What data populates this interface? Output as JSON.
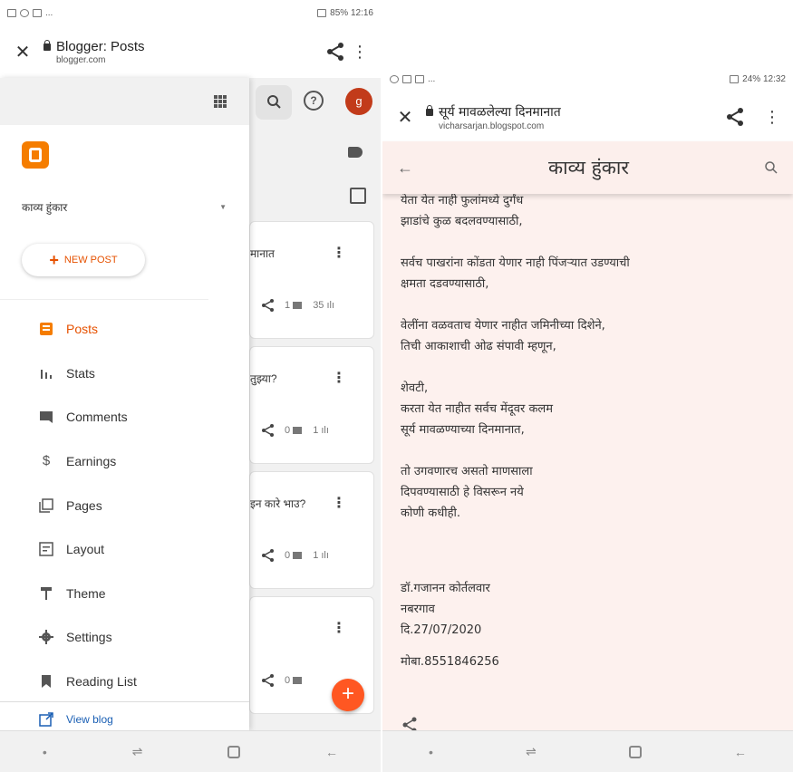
{
  "left_phone": {
    "status": {
      "right": "85%  12:16",
      "left": "..."
    },
    "browser": {
      "title": "Blogger: Posts",
      "url": "blogger.com"
    },
    "header": {
      "avatar_letter": "g",
      "help_glyph": "?"
    },
    "posts": [
      {
        "title": "मानात",
        "comments": "1",
        "views": "35"
      },
      {
        "title": "तुझ्या?",
        "comments": "0",
        "views": "1"
      },
      {
        "title": "इन कारे भाउ?",
        "comments": "0",
        "views": "1"
      },
      {
        "title": "",
        "comments": "0",
        "views": ""
      }
    ],
    "drawer": {
      "blog_name": "काव्य हुंकार",
      "new_post": "NEW POST",
      "nav": [
        {
          "label": "Posts",
          "icon": "posts-icon",
          "active": true
        },
        {
          "label": "Stats",
          "icon": "stats-icon",
          "active": false
        },
        {
          "label": "Comments",
          "icon": "comments-icon",
          "active": false
        },
        {
          "label": "Earnings",
          "icon": "earnings-icon",
          "active": false
        },
        {
          "label": "Pages",
          "icon": "pages-icon",
          "active": false
        },
        {
          "label": "Layout",
          "icon": "layout-icon",
          "active": false
        },
        {
          "label": "Theme",
          "icon": "theme-icon",
          "active": false
        },
        {
          "label": "Settings",
          "icon": "settings-icon",
          "active": false
        },
        {
          "label": "Reading List",
          "icon": "reading-list-icon",
          "active": false
        }
      ],
      "view_blog": "View blog"
    },
    "fab_label": "+",
    "colors": {
      "accent": "#e65100",
      "fab": "#ff5722",
      "avatar": "#c23b1a",
      "logo": "#f57d00"
    }
  },
  "right_phone": {
    "status": {
      "right": "24%  12:32",
      "left": "..."
    },
    "browser": {
      "title": "सूर्य मावळलेल्या दिनमानात",
      "url": "vicharsarjan.blogspot.com"
    },
    "blog_title": "काव्य हुंकार",
    "poem": [
      [
        "येता येत नाही फुलांमध्ये दुर्गंध",
        "झाडांचे कुळ बदलवण्यासाठी,"
      ],
      [
        "सर्वच पाखरांना कोंडता येणार नाही पिंजऱ्यात उडण्याची",
        "क्षमता दडवण्यासाठी,"
      ],
      [
        "वेलींना वळवताच येणार नाहीत जमिनीच्या दिशेने,",
        "तिची आकाशाची ओढ संपावी म्हणून,"
      ],
      [
        "शेवटी,",
        "करता येत नाहीत सर्वच मेंदूवर कलम",
        "सूर्य मावळण्याच्या दिनमानात,"
      ],
      [
        "तो उगवणारच असतो माणसाला",
        "दिपवण्यासाठी हे विसरून नये",
        "कोणी कधीही."
      ]
    ],
    "signature": {
      "author": "डॉ.गजानन कोर्तलवार",
      "place": "नबरगाव",
      "date": "दि.27/07/2020",
      "phone": "मोबा.8551846256"
    }
  }
}
